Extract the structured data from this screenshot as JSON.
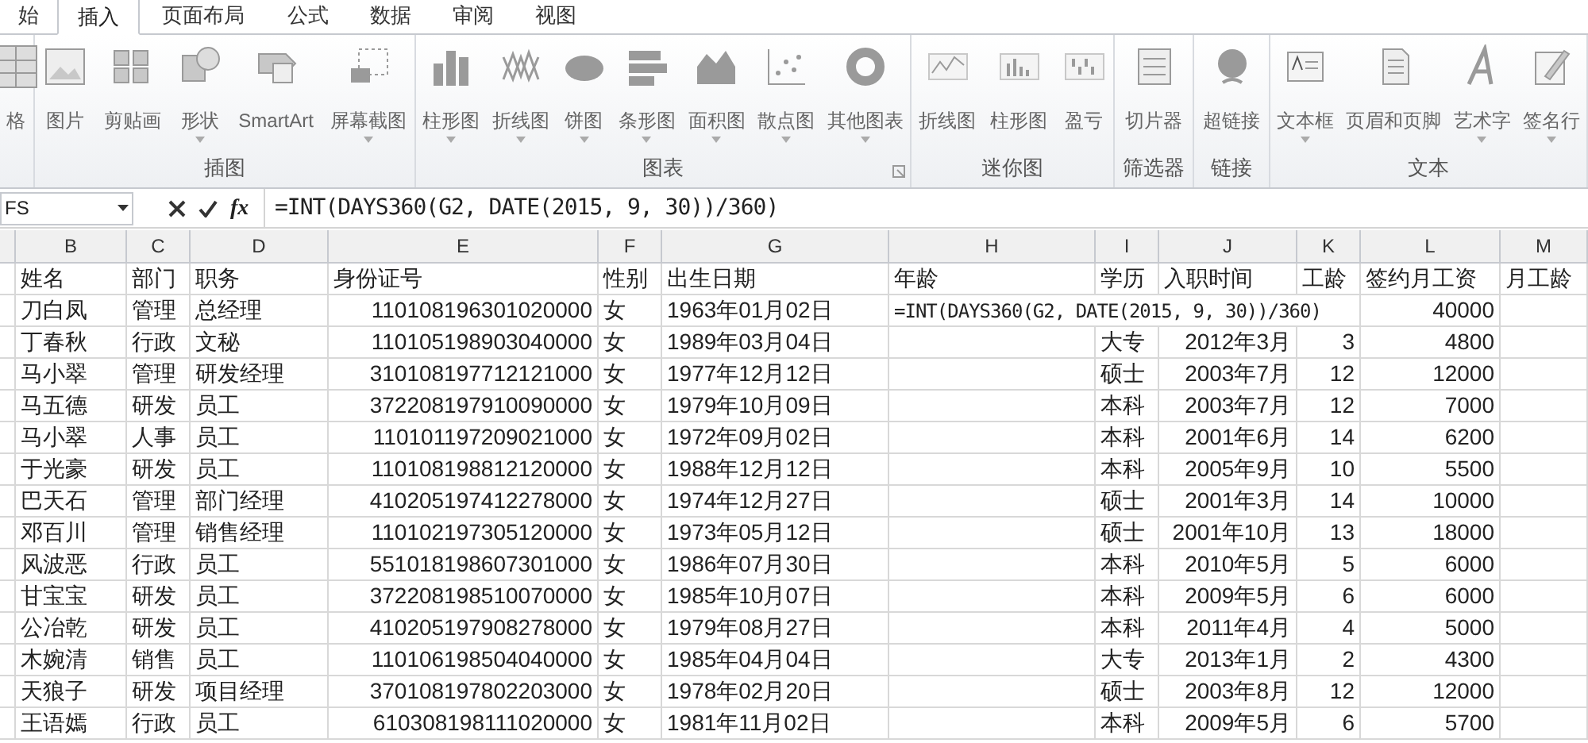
{
  "ribbon_tabs": [
    {
      "label": "始",
      "selected": false
    },
    {
      "label": "插入",
      "selected": true
    },
    {
      "label": "页面布局",
      "selected": false
    },
    {
      "label": "公式",
      "selected": false
    },
    {
      "label": "数据",
      "selected": false
    },
    {
      "label": "审阅",
      "selected": false
    },
    {
      "label": "视图",
      "selected": false
    }
  ],
  "ribbon_groups": [
    {
      "launcher": false,
      "items": [
        {
          "label": "格",
          "dropdown": false
        }
      ]
    },
    {
      "label": "插图",
      "launcher": false,
      "items": [
        {
          "label": "图片",
          "dropdown": false
        },
        {
          "label": "剪贴画",
          "dropdown": false
        },
        {
          "label": "形状",
          "dropdown": true
        },
        {
          "label": "SmartArt",
          "dropdown": false
        },
        {
          "label": "屏幕截图",
          "dropdown": true
        }
      ]
    },
    {
      "label": "图表",
      "launcher": true,
      "items": [
        {
          "label": "柱形图",
          "dropdown": true
        },
        {
          "label": "折线图",
          "dropdown": true
        },
        {
          "label": "饼图",
          "dropdown": true
        },
        {
          "label": "条形图",
          "dropdown": true
        },
        {
          "label": "面积图",
          "dropdown": true
        },
        {
          "label": "散点图",
          "dropdown": true
        },
        {
          "label": "其他图表",
          "dropdown": true
        }
      ]
    },
    {
      "label": "迷你图",
      "launcher": false,
      "items": [
        {
          "label": "折线图",
          "dropdown": false
        },
        {
          "label": "柱形图",
          "dropdown": false
        },
        {
          "label": "盈亏",
          "dropdown": false
        }
      ]
    },
    {
      "label": "筛选器",
      "launcher": false,
      "items": [
        {
          "label": "切片器",
          "dropdown": false
        }
      ]
    },
    {
      "label": "链接",
      "launcher": false,
      "items": [
        {
          "label": "超链接",
          "dropdown": false
        }
      ]
    },
    {
      "label": "文本",
      "launcher": false,
      "items": [
        {
          "label": "文本框",
          "dropdown": true
        },
        {
          "label": "页眉和页脚",
          "dropdown": false
        },
        {
          "label": "艺术字",
          "dropdown": true
        },
        {
          "label": "签名行",
          "dropdown": true
        }
      ]
    }
  ],
  "formula_bar": {
    "name_box": "FS",
    "function_button": "fx",
    "formula": "=INT(DAYS360(G2, DATE(2015, 9, 30))/360)"
  },
  "sheet": {
    "columns": [
      {
        "letter": "B",
        "heading": "姓名"
      },
      {
        "letter": "C",
        "heading": "部门"
      },
      {
        "letter": "D",
        "heading": "职务"
      },
      {
        "letter": "E",
        "heading": "身份证号"
      },
      {
        "letter": "F",
        "heading": "性别"
      },
      {
        "letter": "G",
        "heading": "出生日期"
      },
      {
        "letter": "H",
        "heading": "年龄"
      },
      {
        "letter": "I",
        "heading": "学历"
      },
      {
        "letter": "J",
        "heading": "入职时间"
      },
      {
        "letter": "K",
        "heading": "工龄"
      },
      {
        "letter": "L",
        "heading": "签约月工资"
      },
      {
        "letter": "M",
        "heading": "月工龄"
      }
    ],
    "rows": [
      {
        "cells": [
          "刀白凤",
          "管理",
          "总经理",
          "110108196301020000",
          "女",
          "1963年01月02日",
          "=INT(DAYS360(G2, DATE(2015, 9, 30))/360)",
          "",
          "",
          "",
          "40000"
        ],
        "editing": true
      },
      {
        "cells": [
          "丁春秋",
          "行政",
          "文秘",
          "110105198903040000",
          "女",
          "1989年03月04日",
          "",
          "大专",
          "2012年3月",
          "3",
          "4800"
        ],
        "editing": false
      },
      {
        "cells": [
          "马小翠",
          "管理",
          "研发经理",
          "310108197712121000",
          "女",
          "1977年12月12日",
          "",
          "硕士",
          "2003年7月",
          "12",
          "12000"
        ],
        "editing": false
      },
      {
        "cells": [
          "马五德",
          "研发",
          "员工",
          "372208197910090000",
          "女",
          "1979年10月09日",
          "",
          "本科",
          "2003年7月",
          "12",
          "7000"
        ],
        "editing": false
      },
      {
        "cells": [
          "马小翠",
          "人事",
          "员工",
          "110101197209021000",
          "女",
          "1972年09月02日",
          "",
          "本科",
          "2001年6月",
          "14",
          "6200"
        ],
        "editing": false
      },
      {
        "cells": [
          "于光豪",
          "研发",
          "员工",
          "110108198812120000",
          "女",
          "1988年12月12日",
          "",
          "本科",
          "2005年9月",
          "10",
          "5500"
        ],
        "editing": false
      },
      {
        "cells": [
          "巴天石",
          "管理",
          "部门经理",
          "410205197412278000",
          "女",
          "1974年12月27日",
          "",
          "硕士",
          "2001年3月",
          "14",
          "10000"
        ],
        "editing": false
      },
      {
        "cells": [
          "邓百川",
          "管理",
          "销售经理",
          "110102197305120000",
          "女",
          "1973年05月12日",
          "",
          "硕士",
          "2001年10月",
          "13",
          "18000"
        ],
        "editing": false
      },
      {
        "cells": [
          "风波恶",
          "行政",
          "员工",
          "551018198607301000",
          "女",
          "1986年07月30日",
          "",
          "本科",
          "2010年5月",
          "5",
          "6000"
        ],
        "editing": false
      },
      {
        "cells": [
          "甘宝宝",
          "研发",
          "员工",
          "372208198510070000",
          "女",
          "1985年10月07日",
          "",
          "本科",
          "2009年5月",
          "6",
          "6000"
        ],
        "editing": false
      },
      {
        "cells": [
          "公冶乾",
          "研发",
          "员工",
          "410205197908278000",
          "女",
          "1979年08月27日",
          "",
          "本科",
          "2011年4月",
          "4",
          "5000"
        ],
        "editing": false
      },
      {
        "cells": [
          "木婉清",
          "销售",
          "员工",
          "110106198504040000",
          "女",
          "1985年04月04日",
          "",
          "大专",
          "2013年1月",
          "2",
          "4300"
        ],
        "editing": false
      },
      {
        "cells": [
          "天狼子",
          "研发",
          "项目经理",
          "370108197802203000",
          "女",
          "1978年02月20日",
          "",
          "硕士",
          "2003年8月",
          "12",
          "12000"
        ],
        "editing": false
      },
      {
        "cells": [
          "王语嫣",
          "行政",
          "员工",
          "610308198111020000",
          "女",
          "1981年11月02日",
          "",
          "本科",
          "2009年5月",
          "6",
          "5700"
        ],
        "editing": false
      }
    ]
  }
}
